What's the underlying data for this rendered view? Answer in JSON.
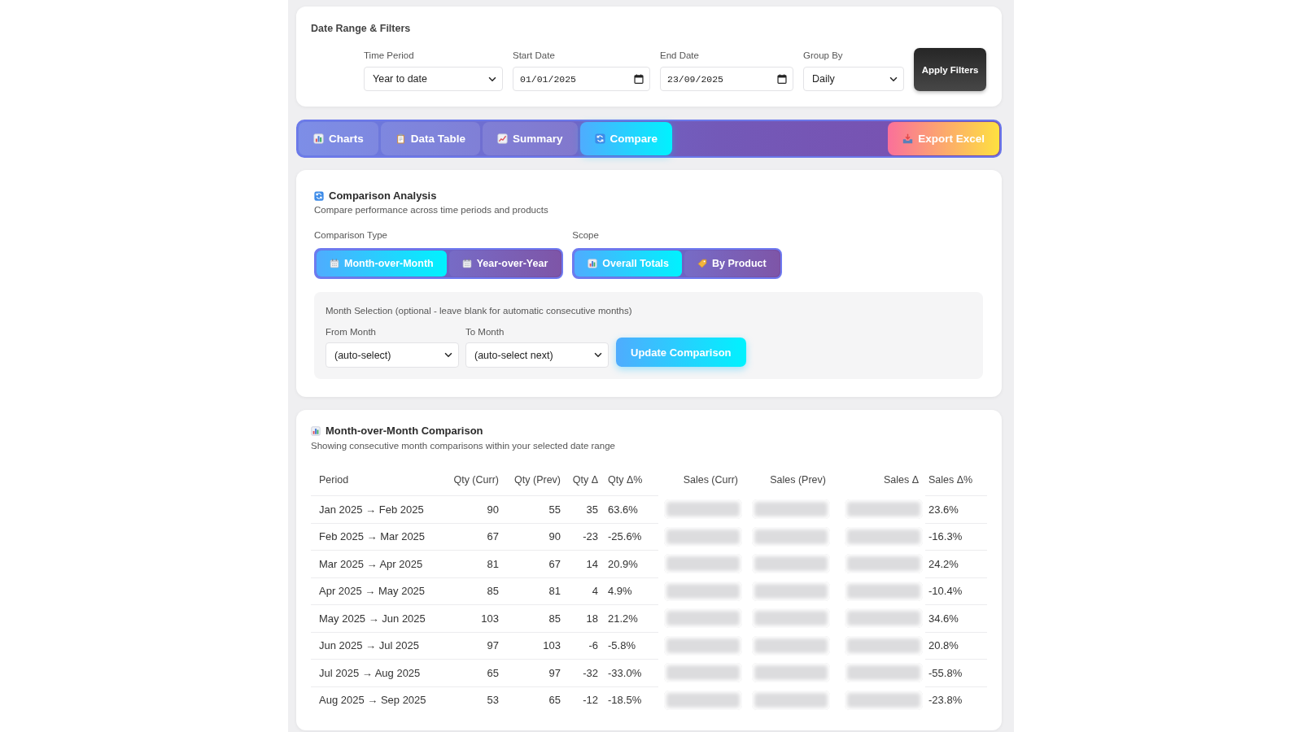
{
  "filters": {
    "title": "Date Range & Filters",
    "fields": [
      {
        "label": "Time Period",
        "value": "Year to date",
        "kind": "select"
      },
      {
        "label": "Start Date",
        "value": "01/01/2025",
        "kind": "date"
      },
      {
        "label": "End Date",
        "value": "23/09/2025",
        "kind": "date"
      },
      {
        "label": "Group By",
        "value": "Daily",
        "kind": "select"
      }
    ],
    "apply_button": "Apply Filters"
  },
  "tabs": [
    {
      "label": "Charts",
      "selected": false
    },
    {
      "label": "Data Table",
      "selected": false
    },
    {
      "label": "Summary",
      "selected": false
    },
    {
      "label": "Compare",
      "selected": true
    }
  ],
  "export_button": "Export Excel",
  "comparison": {
    "title": "Comparison Analysis",
    "subtitle": "Compare performance across time periods and products",
    "comparison_type": {
      "label": "Comparison Type",
      "options": [
        {
          "label": "Month-over-Month",
          "selected": true
        },
        {
          "label": "Year-over-Year",
          "selected": false
        }
      ]
    },
    "scope": {
      "label": "Scope",
      "options": [
        {
          "label": "Overall Totals",
          "selected": true
        },
        {
          "label": "By Product",
          "selected": false
        }
      ]
    },
    "month_selection": {
      "note": "Month Selection (optional - leave blank for automatic consecutive months)",
      "fields": [
        {
          "label": "From Month",
          "value": "(auto-select)"
        },
        {
          "label": "To Month",
          "value": "(auto-select next)"
        }
      ],
      "button": "Update Comparison"
    }
  },
  "results": {
    "title": "Month-over-Month Comparison",
    "subtitle": "Showing consecutive month comparisons within your selected date range",
    "columns": [
      {
        "label": "Period",
        "kind": "text"
      },
      {
        "label": "Qty (Curr)",
        "kind": "number"
      },
      {
        "label": "Qty (Prev)",
        "kind": "number"
      },
      {
        "label": "Qty Δ",
        "kind": "number"
      },
      {
        "label": "Qty Δ%",
        "kind": "percent"
      },
      {
        "label": "Sales (Curr)",
        "kind": "blurred"
      },
      {
        "label": "Sales (Prev)",
        "kind": "blurred"
      },
      {
        "label": "Sales Δ",
        "kind": "blurred"
      },
      {
        "label": "Sales Δ%",
        "kind": "percent"
      }
    ],
    "rows": [
      {
        "cells": [
          "Jan 2025 → Feb 2025",
          "90",
          "55",
          "35",
          "63.6%",
          "23.6%"
        ]
      },
      {
        "cells": [
          "Feb 2025 → Mar 2025",
          "67",
          "90",
          "-23",
          "-25.6%",
          "-16.3%"
        ]
      },
      {
        "cells": [
          "Mar 2025 → Apr 2025",
          "81",
          "67",
          "14",
          "20.9%",
          "24.2%"
        ]
      },
      {
        "cells": [
          "Apr 2025 → May 2025",
          "85",
          "81",
          "4",
          "4.9%",
          "-10.4%"
        ]
      },
      {
        "cells": [
          "May 2025 → Jun 2025",
          "103",
          "85",
          "18",
          "21.2%",
          "34.6%"
        ]
      },
      {
        "cells": [
          "Jun 2025 → Jul 2025",
          "97",
          "103",
          "-6",
          "-5.8%",
          "20.8%"
        ]
      },
      {
        "cells": [
          "Jul 2025 → Aug 2025",
          "65",
          "97",
          "-32",
          "-33.0%",
          "-55.8%"
        ]
      },
      {
        "cells": [
          "Aug 2025 → Sep 2025",
          "53",
          "65",
          "-12",
          "-18.5%",
          "-23.8%"
        ]
      }
    ]
  }
}
